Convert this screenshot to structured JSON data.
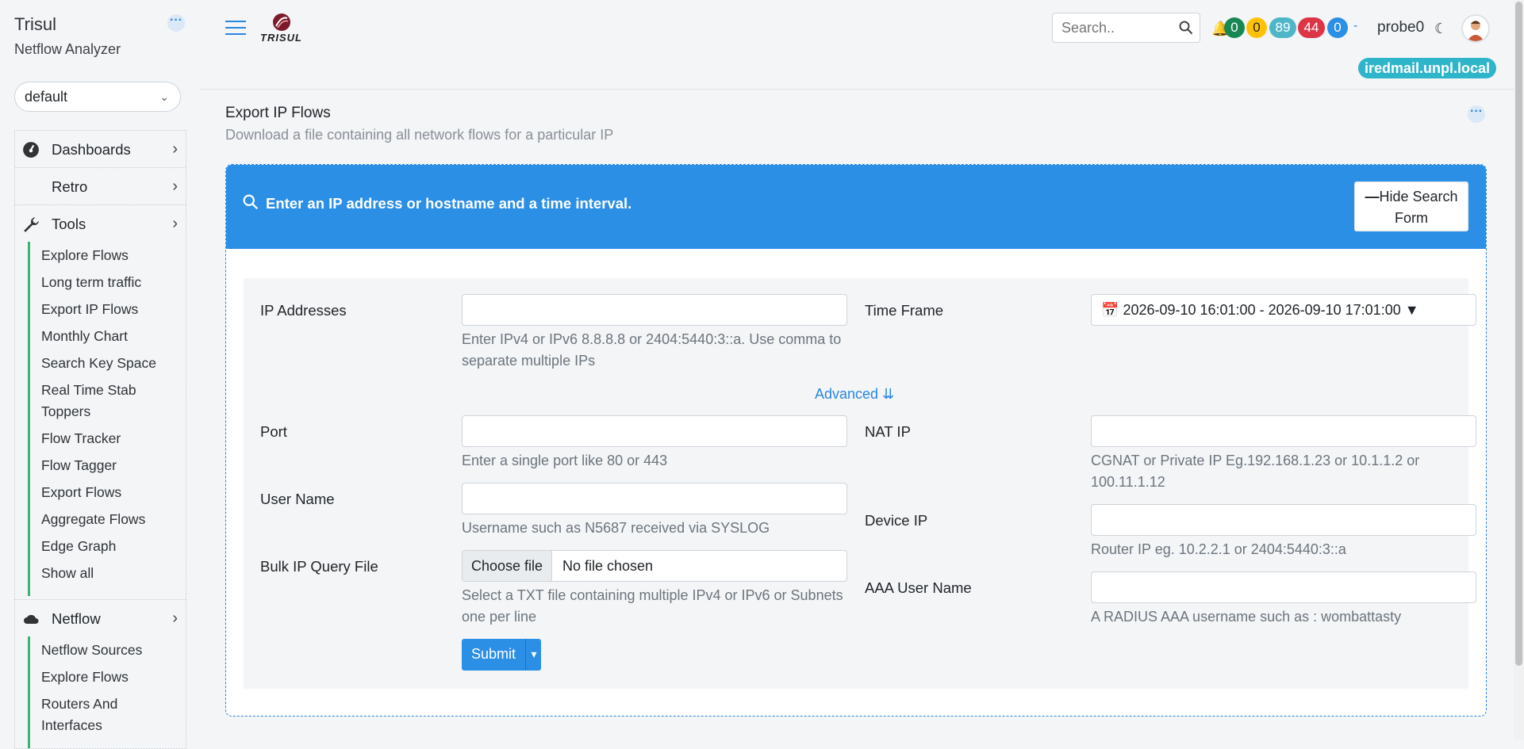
{
  "sidebar": {
    "app_name": "Trisul",
    "app_sub": "Netflow Analyzer",
    "context_select": "default",
    "nav": [
      {
        "label": "Dashboards",
        "icon": "dashboard-icon"
      },
      {
        "label": "Retro"
      },
      {
        "label": "Tools",
        "icon": "wrench-icon"
      }
    ],
    "tools_items": [
      "Explore Flows",
      "Long term traffic",
      "Export IP Flows",
      "Monthly Chart",
      "Search Key Space",
      "Real Time Stab Toppers",
      "Flow Tracker",
      "Flow Tagger",
      "Export Flows",
      "Aggregate Flows",
      "Edge Graph",
      "Show all"
    ],
    "netflow": {
      "label": "Netflow",
      "icon": "cloud-icon"
    },
    "netflow_items": [
      "Netflow Sources",
      "Explore Flows",
      "Routers And Interfaces"
    ]
  },
  "topbar": {
    "logo_text": "TRISUL",
    "search_placeholder": "Search..",
    "badges": [
      {
        "value": "0",
        "color": "#198754"
      },
      {
        "value": "0",
        "color": "#ffc107"
      },
      {
        "value": "89",
        "color": "#4fb6c8"
      },
      {
        "value": "44",
        "color": "#dc3545"
      },
      {
        "value": "0",
        "color": "#2b8fe6"
      }
    ],
    "badge_dash": "-",
    "probe": "probe0",
    "host": "iredmail.unpl.local"
  },
  "page": {
    "title": "Export IP Flows",
    "subtitle": "Download a file containing all network flows for a particular IP"
  },
  "search_card": {
    "header_text": "Enter an IP address or hostname and a time interval.",
    "hide_button": "Hide Search Form",
    "fields": {
      "ip_label": "IP Addresses",
      "ip_help": "Enter IPv4 or IPv6 8.8.8.8 or 2404:5440:3::a. Use comma to separate multiple IPs",
      "timeframe_label": "Time Frame",
      "timeframe_value": "2026-09-10 16:01:00 - 2026-09-10 17:01:00",
      "advanced": "Advanced",
      "port_label": "Port",
      "port_help": "Enter a single port like 80 or 443",
      "natip_label": "NAT IP",
      "natip_help": "CGNAT or Private IP Eg.192.168.1.23 or 10.1.1.2 or 100.11.1.12",
      "username_label": "User Name",
      "username_help": "Username such as N5687 received via SYSLOG",
      "deviceip_label": "Device IP",
      "deviceip_help": "Router IP eg. 10.2.2.1 or 2404:5440:3::a",
      "bulk_label": "Bulk IP Query File",
      "choose_file": "Choose file",
      "no_file": "No file chosen",
      "bulk_help": "Select a TXT file containing multiple IPv4 or IPv6 or Subnets one per line",
      "aaa_label": "AAA User Name",
      "aaa_help": "A RADIUS AAA username such as : wombattasty",
      "submit": "Submit"
    }
  }
}
